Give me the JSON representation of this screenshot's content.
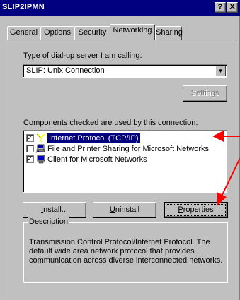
{
  "window": {
    "title": "SLIP2IPMN",
    "help_glyph": "?",
    "close_glyph": "X"
  },
  "tabs": [
    {
      "label": "General",
      "active": false
    },
    {
      "label": "Options",
      "active": false
    },
    {
      "label": "Security",
      "active": false
    },
    {
      "label": "Networking",
      "active": true
    },
    {
      "label": "Sharing",
      "active": false
    }
  ],
  "server": {
    "label_prefix": "Ty",
    "label_underline": "p",
    "label_suffix": "e of dial-up server I am calling:",
    "selected": "SLIP: Unix Connection",
    "settings_button": "Settings"
  },
  "components": {
    "label_underline": "C",
    "label_suffix": "omponents checked are used by this connection:",
    "items": [
      {
        "label": "Internet Protocol (TCP/IP)",
        "checked": true,
        "selected": true,
        "icon": "network-protocol-icon"
      },
      {
        "label": "File and Printer Sharing for Microsoft Networks",
        "checked": false,
        "selected": false,
        "icon": "printer-sharing-icon"
      },
      {
        "label": "Client for Microsoft Networks",
        "checked": true,
        "selected": false,
        "icon": "network-client-icon"
      }
    ]
  },
  "buttons": {
    "install_u": "I",
    "install_rest": "nstall...",
    "uninstall_u": "U",
    "uninstall_rest": "ninstall",
    "properties_u": "P",
    "properties_rest": "roperties"
  },
  "description": {
    "title": "Description",
    "text": "Transmission Control Protocol/Internet Protocol. The default wide area network protocol that provides communication across diverse interconnected networks."
  },
  "colors": {
    "title_bar": "#000080",
    "selection": "#000080",
    "annotation_arrow": "#ff0000"
  }
}
